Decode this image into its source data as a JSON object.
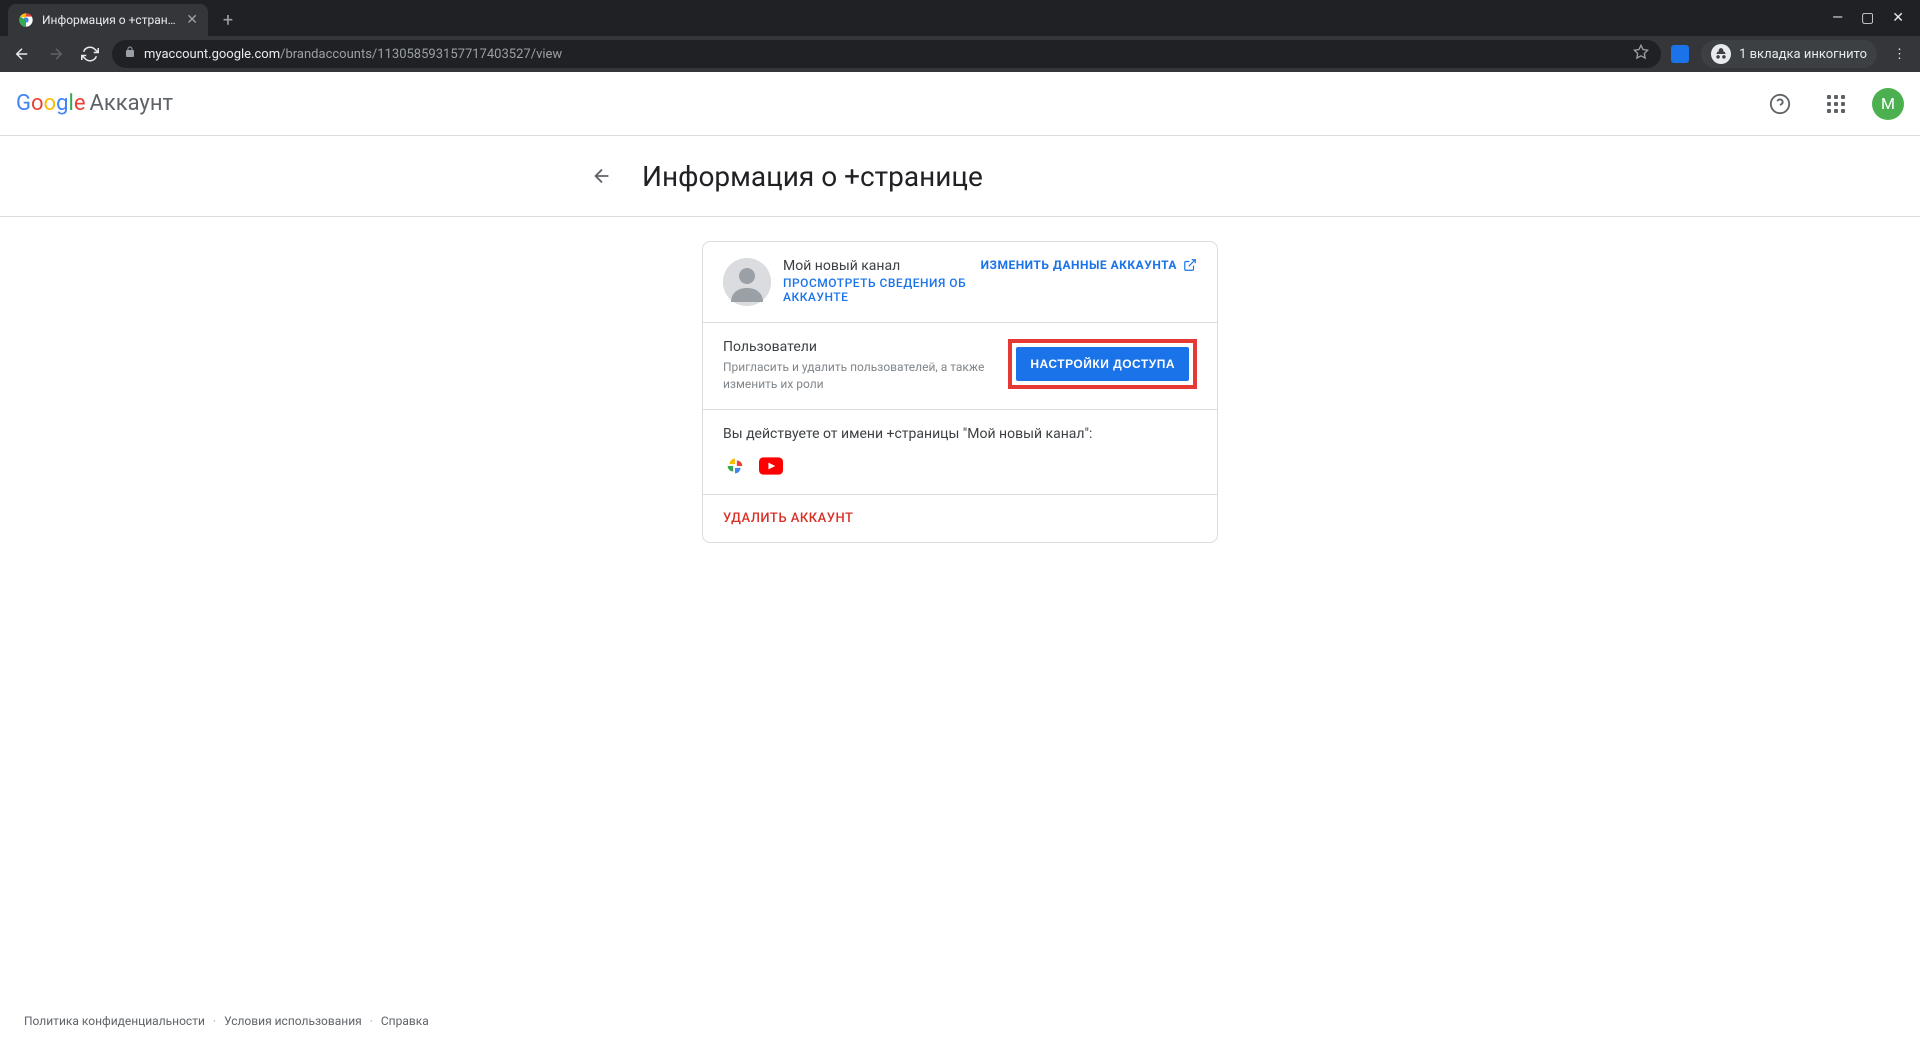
{
  "browser": {
    "tab_title": "Информация о +странице",
    "url_main": "myaccount.google.com",
    "url_path": "/brandaccounts/113058593157717403527/view",
    "incognito_label": "1 вкладка инкогнито"
  },
  "header": {
    "logo_text": "Аккаунт",
    "avatar_letter": "M"
  },
  "page": {
    "title": "Информация о +странице"
  },
  "account_section": {
    "name": "Мой новый канал",
    "view_details": "ПРОСМОТРЕТЬ СВЕДЕНИЯ ОБ АККАУНТЕ",
    "change_data": "ИЗМЕНИТЬ ДАННЫЕ АККАУНТА"
  },
  "users_section": {
    "title": "Пользователи",
    "description": "Пригласить и удалить пользователей, а также изменить их роли",
    "button": "НАСТРОЙКИ ДОСТУПА"
  },
  "acting_section": {
    "text": "Вы действуете от имени +страницы \"Мой новый канал\":"
  },
  "delete_section": {
    "label": "УДАЛИТЬ АККАУНТ"
  },
  "footer": {
    "privacy": "Политика конфиденциальности",
    "terms": "Условия использования",
    "help": "Справка"
  }
}
